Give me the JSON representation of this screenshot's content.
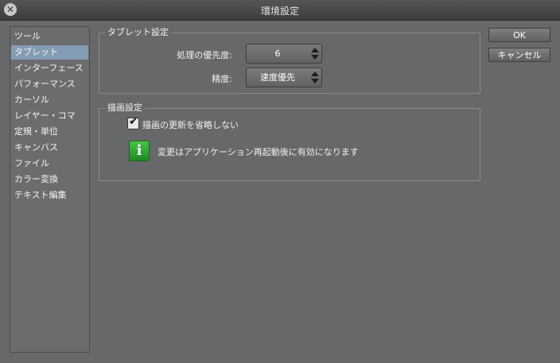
{
  "window": {
    "title": "環境設定"
  },
  "sidebar": {
    "items": [
      {
        "label": "ツール",
        "selected": false
      },
      {
        "label": "タブレット",
        "selected": true
      },
      {
        "label": "インターフェース",
        "selected": false
      },
      {
        "label": "パフォーマンス",
        "selected": false
      },
      {
        "label": "カーソル",
        "selected": false
      },
      {
        "label": "レイヤー・コマ",
        "selected": false
      },
      {
        "label": "定規・単位",
        "selected": false
      },
      {
        "label": "キャンバス",
        "selected": false
      },
      {
        "label": "ファイル",
        "selected": false
      },
      {
        "label": "カラー変換",
        "selected": false
      },
      {
        "label": "テキスト編集",
        "selected": false
      }
    ]
  },
  "tablet": {
    "group_label": "タブレット設定",
    "priority_label": "処理の優先度:",
    "priority_value": "6",
    "precision_label": "精度:",
    "precision_value": "速度優先"
  },
  "drawing": {
    "group_label": "描画設定",
    "skip_update_label": "描画の更新を省略しない",
    "skip_update_checked": true,
    "info_text": "変更はアプリケーション再起動後に有効になります"
  },
  "buttons": {
    "ok": "OK",
    "cancel": "キャンセル"
  },
  "icons": {
    "close": "close-icon",
    "info": "info-icon",
    "check": "check-icon"
  },
  "colors": {
    "selection": "#839cb3",
    "info_green": "#2fa834"
  }
}
